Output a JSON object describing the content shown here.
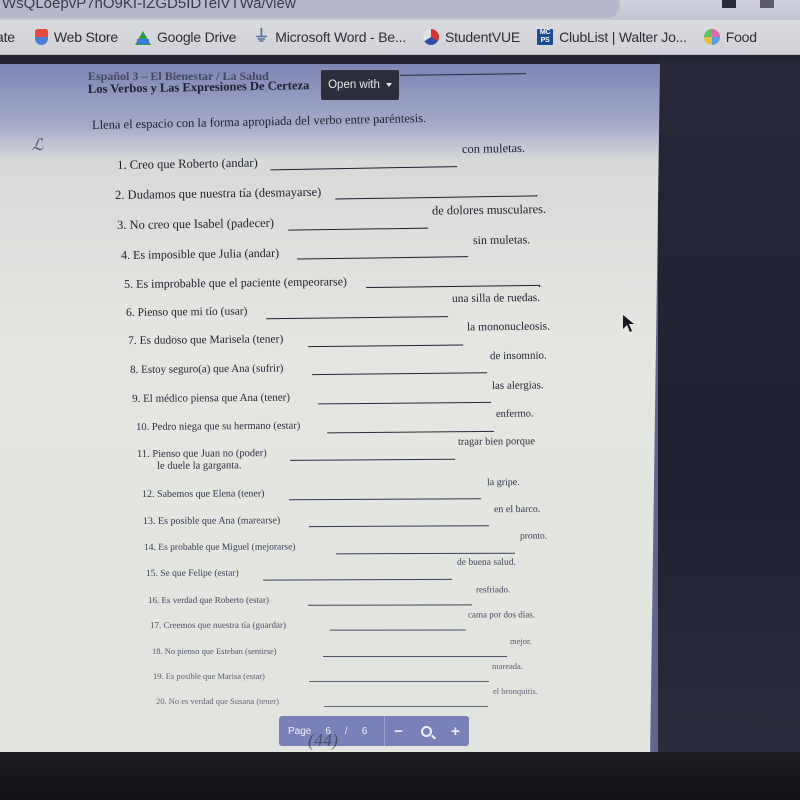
{
  "browser": {
    "url_fragment": "WsQLoepvP7hO9KI-IZGD5IDTeiVTWa/view",
    "bookmarks": [
      {
        "label": "ate",
        "icon": "apps-icon"
      },
      {
        "label": "Web Store",
        "icon": "web-store-icon"
      },
      {
        "label": "Google Drive",
        "icon": "google-drive-icon"
      },
      {
        "label": "Microsoft Word - Be...",
        "icon": "word-icon"
      },
      {
        "label": "StudentVUE",
        "icon": "studentvue-icon"
      },
      {
        "label": "ClubList | Walter Jo...",
        "icon": "mcps-icon"
      },
      {
        "label": "Food",
        "icon": "food-icon"
      }
    ]
  },
  "viewer": {
    "open_with_label": "Open with",
    "page_label": "Page",
    "current_page": "6",
    "page_separator": "/",
    "total_pages": "6",
    "zoom_out": "−",
    "zoom_in": "+",
    "handwriting": "(44)"
  },
  "document": {
    "header_line1": "Español 3 – El Bienestar / La Salud",
    "header_line2": "Los Verbos y Las Expresiones De Certeza",
    "instructions": "Llena el espacio con la forma apropiada del verbo entre paréntesis.",
    "items": [
      {
        "num": "1.",
        "prompt": "Creo que Roberto (andar)",
        "tail": "con muletas."
      },
      {
        "num": "2.",
        "prompt": "Dudamos que nuestra tía (desmayarse)",
        "tail": "."
      },
      {
        "num": "3.",
        "prompt": "No creo que Isabel (padecer)",
        "tail": "de dolores musculares."
      },
      {
        "num": "4.",
        "prompt": "Es imposible que Julia (andar)",
        "tail": "sin muletas."
      },
      {
        "num": "5.",
        "prompt": "Es improbable que el paciente (empeorarse)",
        "tail": "."
      },
      {
        "num": "6.",
        "prompt": "Pienso que mi tío (usar)",
        "tail": "una silla de ruedas."
      },
      {
        "num": "7.",
        "prompt": "Es dudoso que Marisela  (tener)",
        "tail": "la mononucleosis."
      },
      {
        "num": "8.",
        "prompt": "Estoy seguro(a) que Ana (sufrir)",
        "tail": "de insomnio."
      },
      {
        "num": "9.",
        "prompt": "El médico piensa que Ana (tener)",
        "tail": "las alergias."
      },
      {
        "num": "10.",
        "prompt": "Pedro niega que su hermano (estar)",
        "tail": "enfermo."
      },
      {
        "num": "11.",
        "prompt": "Pienso que Juan no (poder)",
        "tail": "tragar bien porque",
        "continuation": "le duele la garganta."
      },
      {
        "num": "12.",
        "prompt": "Sabemos que Elena (tener)",
        "tail": "la gripe."
      },
      {
        "num": "13.",
        "prompt": "Es posible que Ana (marearse)",
        "tail": "en el barco."
      },
      {
        "num": "14.",
        "prompt": "Es probable que Miguel (mejorarse)",
        "tail": "pronto."
      },
      {
        "num": "15.",
        "prompt": "Se que Felipe (estar)",
        "tail": "de buena salud."
      },
      {
        "num": "16.",
        "prompt": "Es verdad que Roberto (estar)",
        "tail": "resfriado."
      },
      {
        "num": "17.",
        "prompt": "Creemos que nuestra tía (guardar)",
        "tail": "cama por dos días."
      },
      {
        "num": "18.",
        "prompt": "No pienso que Esteban (sentirse)",
        "tail": "mejor."
      },
      {
        "num": "19.",
        "prompt": "Es posible que Marisa (estar)",
        "tail": "mareada."
      },
      {
        "num": "20.",
        "prompt": "No es verdad que Susana (tener)",
        "tail": "el bronquitis."
      }
    ]
  }
}
